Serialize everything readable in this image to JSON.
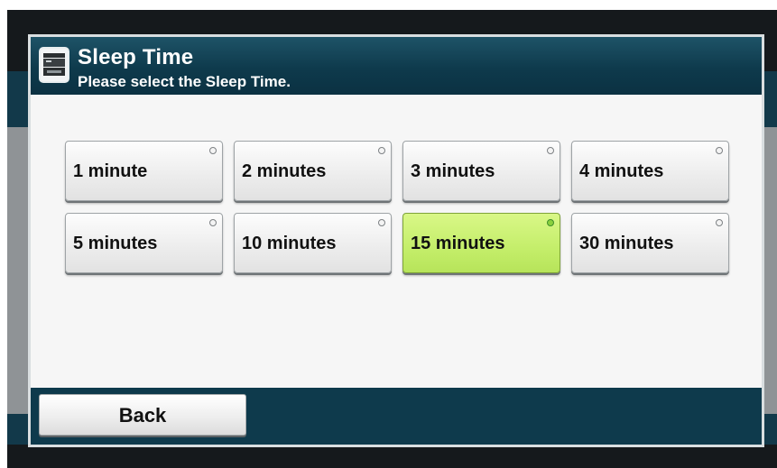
{
  "header": {
    "title": "Sleep Time",
    "subtitle": "Please select the Sleep Time.",
    "icon": "printer-icon"
  },
  "options": [
    {
      "label": "1 minute",
      "selected": false
    },
    {
      "label": "2 minutes",
      "selected": false
    },
    {
      "label": "3 minutes",
      "selected": false
    },
    {
      "label": "4 minutes",
      "selected": false
    },
    {
      "label": "5 minutes",
      "selected": false
    },
    {
      "label": "10 minutes",
      "selected": false
    },
    {
      "label": "15 minutes",
      "selected": true
    },
    {
      "label": "30 minutes",
      "selected": false
    }
  ],
  "footer": {
    "back_label": "Back"
  },
  "colors": {
    "header_bg": "#0e3a4c",
    "selected_bg": "#c4ee6a",
    "button_bg": "#ececec"
  }
}
